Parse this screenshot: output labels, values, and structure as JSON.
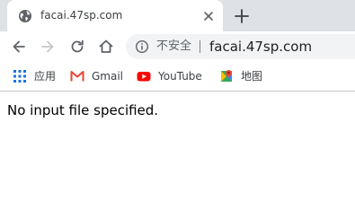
{
  "tab": {
    "title": "facai.47sp.com",
    "favicon": "globe-icon",
    "close": "close-icon"
  },
  "new_tab": "plus-icon",
  "toolbar": {
    "back": "back-arrow-icon",
    "forward": "forward-arrow-icon",
    "reload": "reload-icon",
    "home": "home-icon"
  },
  "omnibox": {
    "security_icon": "info-icon",
    "security_text": "不安全",
    "url": "facai.47sp.com"
  },
  "bookmarks": [
    {
      "label": "应用",
      "icon": "apps-grid-icon"
    },
    {
      "label": "Gmail",
      "icon": "gmail-icon"
    },
    {
      "label": "YouTube",
      "icon": "youtube-icon"
    },
    {
      "label": "地图",
      "icon": "maps-icon"
    }
  ],
  "page": {
    "message": "No input file specified."
  },
  "colors": {
    "tabstrip": "#dee1e6",
    "omnibox": "#f1f3f4",
    "icon": "#5f6368",
    "gmail_red": "#ea4335",
    "youtube_red": "#ff0000"
  }
}
